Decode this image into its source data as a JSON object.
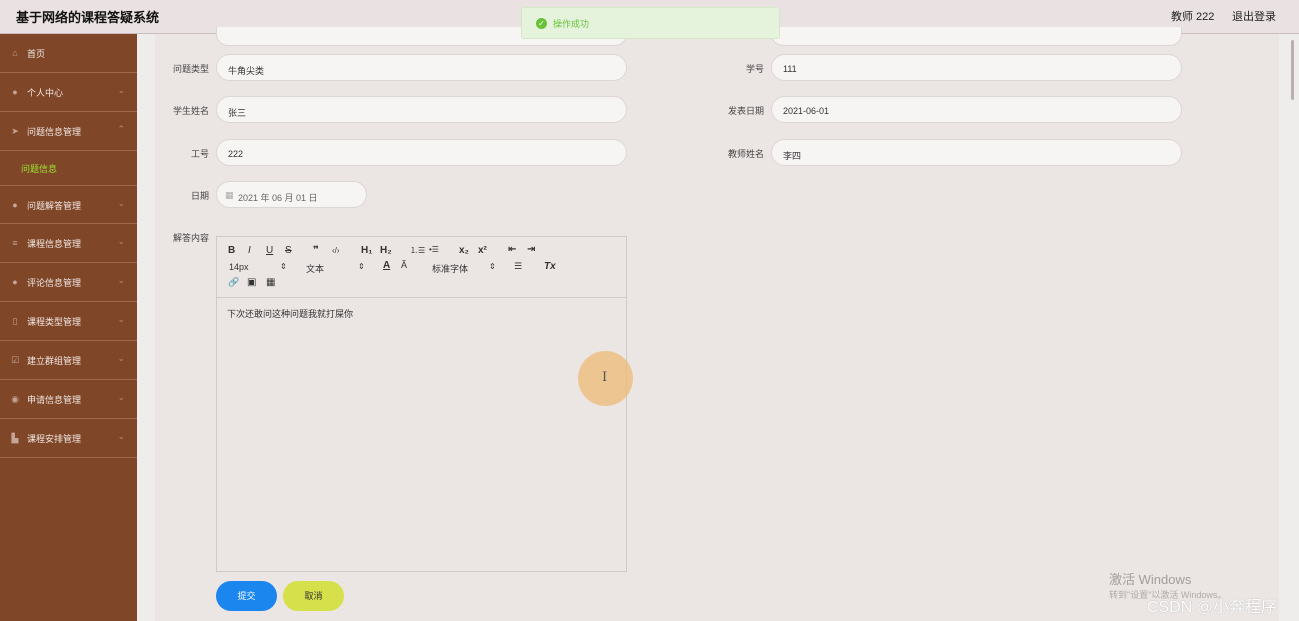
{
  "header": {
    "app_title": "基于网络的课程答疑系统",
    "user_label": "教师 222",
    "logout": "退出登录"
  },
  "toast": {
    "message": "操作成功",
    "color": "#67c23a"
  },
  "sidebar": {
    "background": "#7f4628",
    "items": [
      {
        "label": "首页",
        "icon": "home-icon"
      },
      {
        "label": "个人中心",
        "icon": "user-icon"
      },
      {
        "label": "问题信息管理",
        "icon": "send-icon",
        "expanded": true
      },
      {
        "label": "问题信息",
        "submenu": true
      },
      {
        "label": "问题解答管理",
        "icon": "user-icon"
      },
      {
        "label": "课程信息管理",
        "icon": "list-icon"
      },
      {
        "label": "评论信息管理",
        "icon": "user-icon"
      },
      {
        "label": "课程类型管理",
        "icon": "phone-icon"
      },
      {
        "label": "建立群组管理",
        "icon": "checkbox-icon"
      },
      {
        "label": "申请信息管理",
        "icon": "location-icon"
      },
      {
        "label": "课程安排管理",
        "icon": "chart-icon"
      }
    ]
  },
  "form": {
    "question_type": {
      "label": "问题类型",
      "value": "牛角尖类"
    },
    "student_id": {
      "label": "学号",
      "value": "111"
    },
    "student_name": {
      "label": "学生姓名",
      "value": "张三"
    },
    "publish_date": {
      "label": "发表日期",
      "value": "2021-06-01"
    },
    "staff_id": {
      "label": "工号",
      "value": "222"
    },
    "teacher_name": {
      "label": "教师姓名",
      "value": "李四"
    },
    "date": {
      "label": "日期",
      "value": "2021 年 06 月 01 日"
    },
    "answer": {
      "label": "解答内容",
      "value": "下次还敢问这种问题我就打屎你"
    }
  },
  "editor_toolbar": {
    "bold": "B",
    "italic": "I",
    "underline": "U",
    "strike": "S",
    "quote": "❞",
    "code": "‹/›",
    "h1": "H₁",
    "h2": "H₂",
    "ordered_list": "⒈☰",
    "bullet_list": "•☰",
    "subscript": "x₂",
    "superscript": "x²",
    "indent_left": "⇤",
    "indent_right": "⇥",
    "font_size": "14px",
    "text_style": "文本",
    "font_family": "标准字体",
    "color": "A",
    "background": "Ã",
    "align": "☰",
    "clear": "Tx",
    "link": "🔗",
    "image": "▣",
    "video": "▦"
  },
  "buttons": {
    "submit": "提交",
    "cancel": "取消"
  },
  "watermarks": {
    "activate": "激活 Windows",
    "activate_hint": "转到\"设置\"以激活 Windows。",
    "csdn": "CSDN @小奔程序"
  }
}
